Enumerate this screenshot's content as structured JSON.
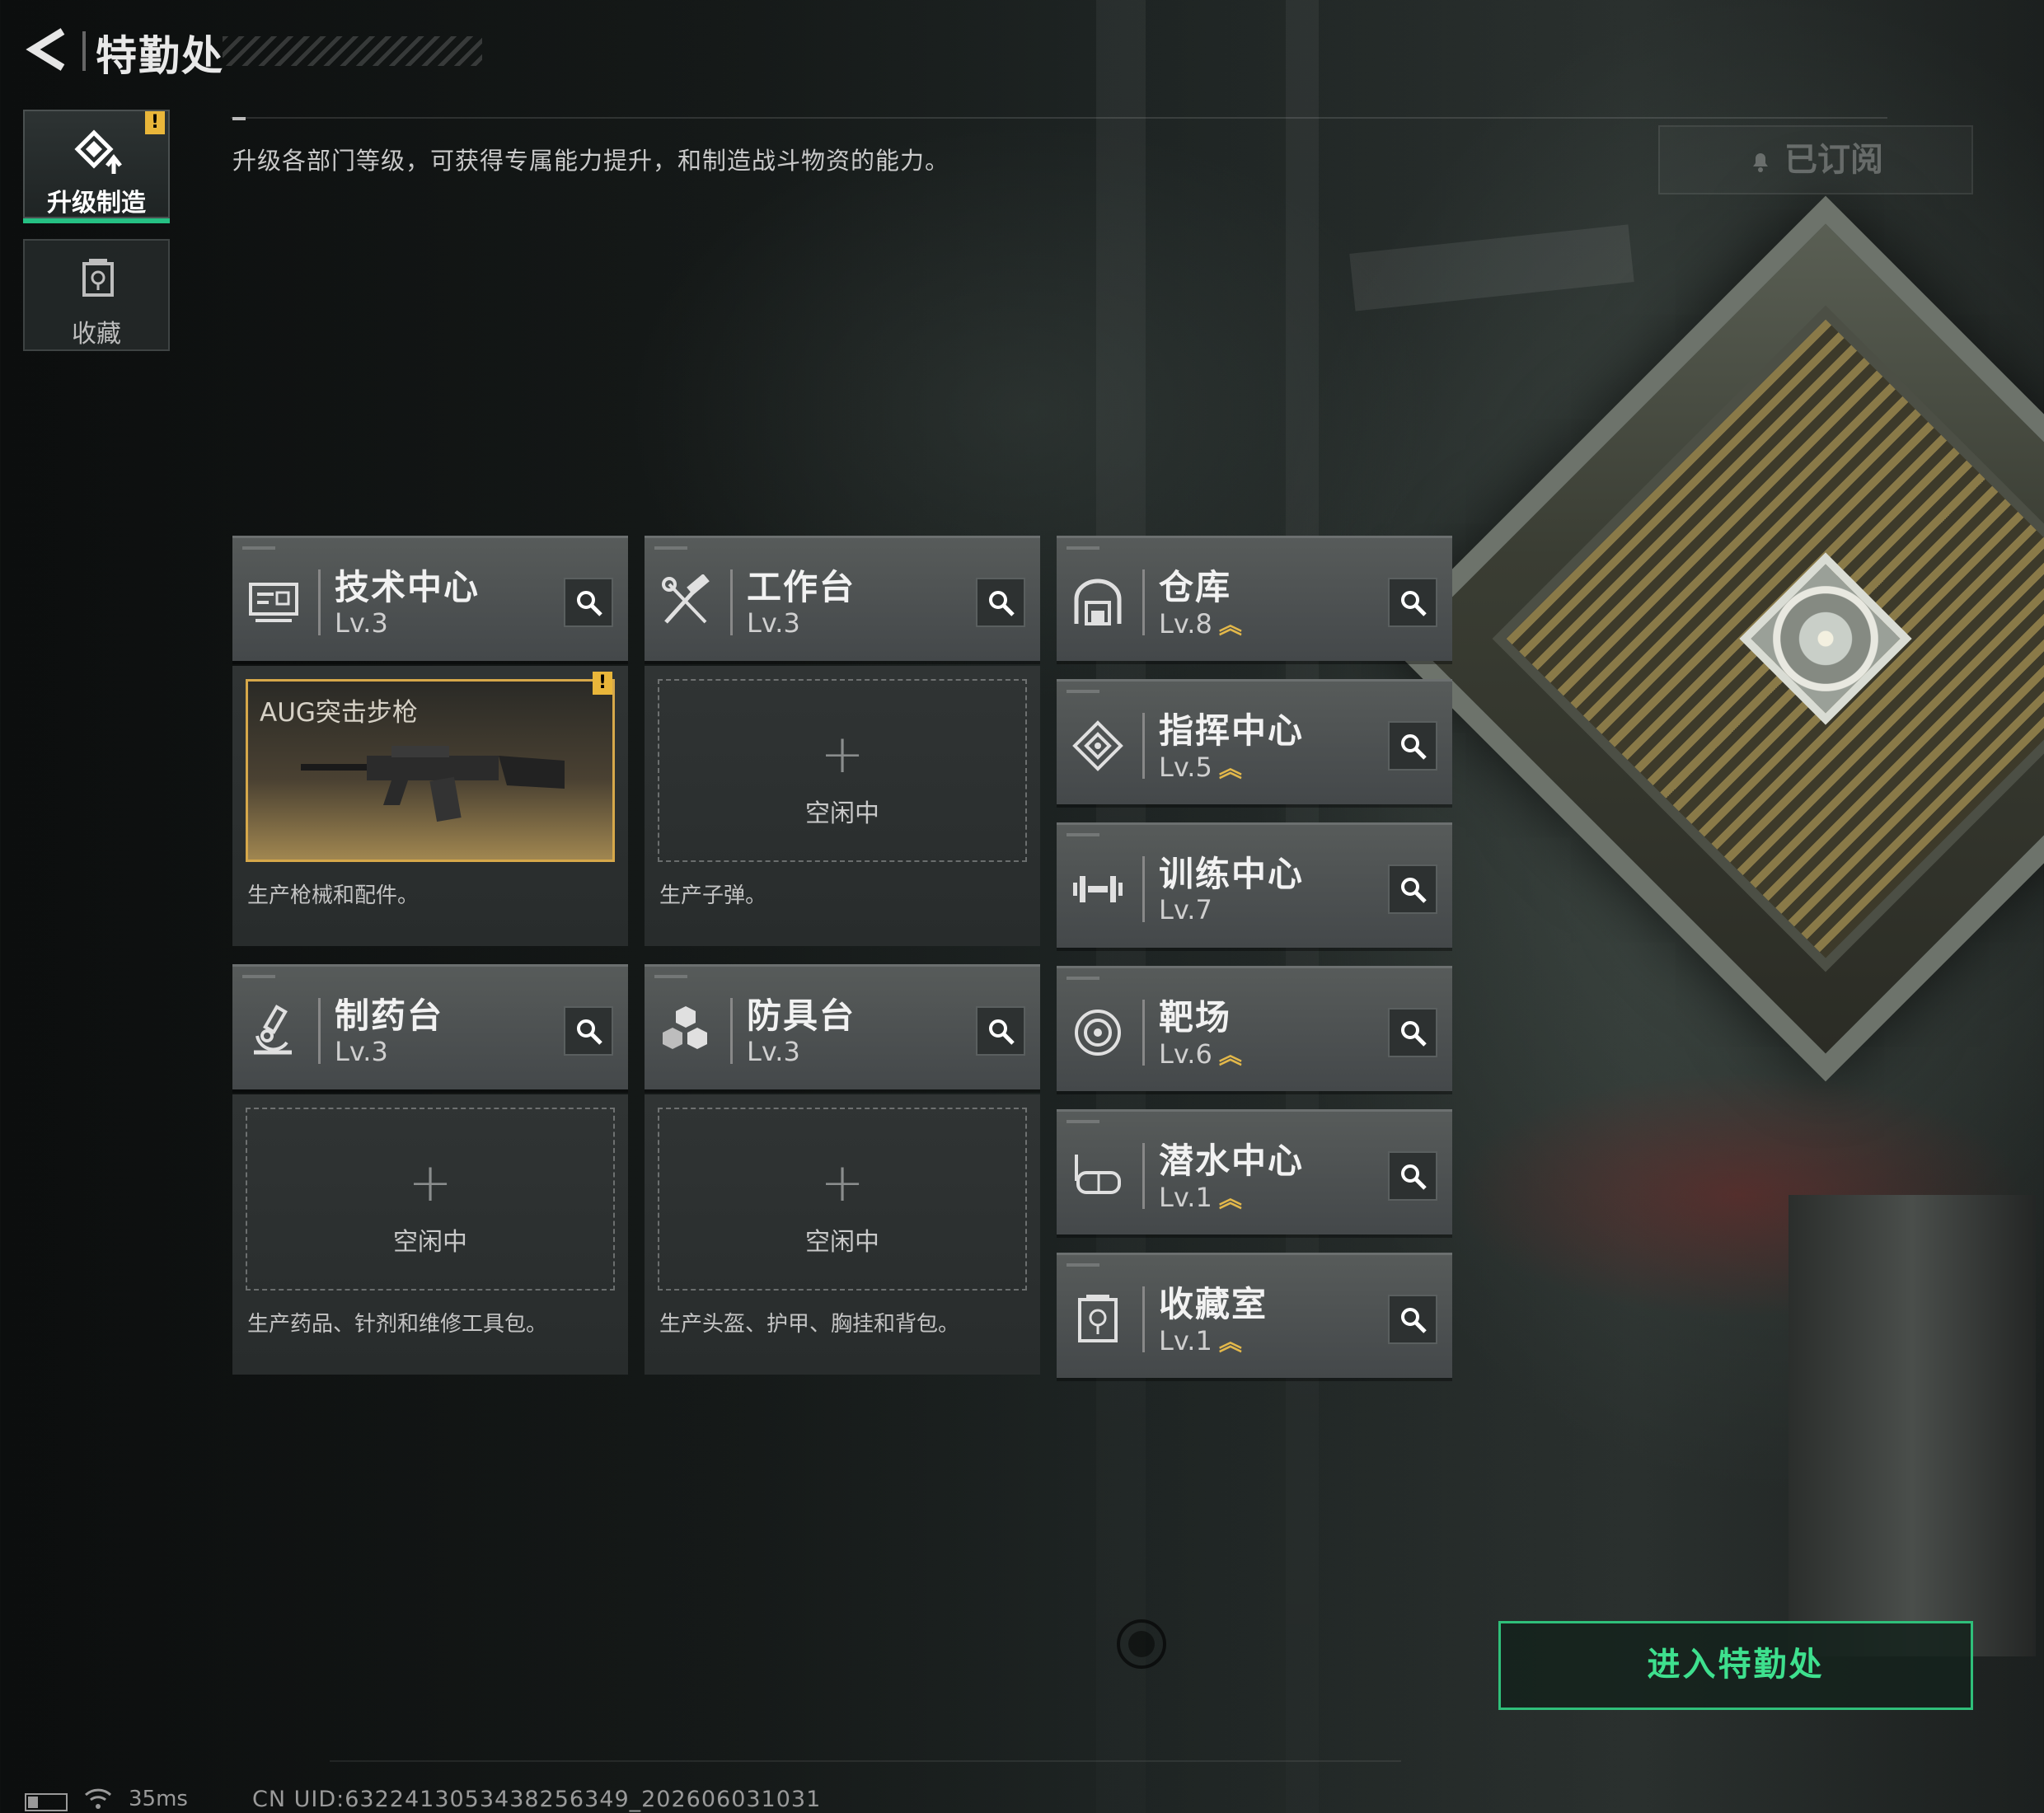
{
  "header": {
    "title": "特勤处"
  },
  "nav": {
    "items": [
      {
        "label": "升级制造",
        "icon": "upgrade-craft-icon",
        "active": true,
        "has_alert": true,
        "alert": "!"
      },
      {
        "label": "收藏",
        "icon": "collection-icon",
        "active": false
      }
    ]
  },
  "main": {
    "description": "升级各部门等级，可获得专属能力提升，和制造战斗物资的能力。",
    "subscribed_label": "已订阅",
    "enter_button": "进入特勤处"
  },
  "departments_left": [
    {
      "name": "技术中心",
      "level": "Lv.3",
      "icon": "monitor-icon",
      "slot": {
        "state": "producing",
        "item_name": "AUG突击步枪",
        "alert": "!"
      },
      "desc": "生产枪械和配件。"
    },
    {
      "name": "工作台",
      "level": "Lv.3",
      "icon": "tools-icon",
      "slot": {
        "state": "idle",
        "plus": "+",
        "idle_label": "空闲中"
      },
      "desc": "生产子弹。"
    },
    {
      "name": "制药台",
      "level": "Lv.3",
      "icon": "microscope-icon",
      "slot": {
        "state": "idle",
        "plus": "+",
        "idle_label": "空闲中"
      },
      "desc": "生产药品、针剂和维修工具包。"
    },
    {
      "name": "防具台",
      "level": "Lv.3",
      "icon": "armor-icon",
      "slot": {
        "state": "idle",
        "plus": "+",
        "idle_label": "空闲中"
      },
      "desc": "生产头盔、护甲、胸挂和背包。"
    }
  ],
  "departments_right": [
    {
      "name": "仓库",
      "level": "Lv.8",
      "upgradable": true,
      "icon": "warehouse-icon"
    },
    {
      "name": "指挥中心",
      "level": "Lv.5",
      "upgradable": true,
      "icon": "command-icon"
    },
    {
      "name": "训练中心",
      "level": "Lv.7",
      "upgradable": false,
      "icon": "dumbbell-icon"
    },
    {
      "name": "靶场",
      "level": "Lv.6",
      "upgradable": true,
      "icon": "target-icon"
    },
    {
      "name": "潜水中心",
      "level": "Lv.1",
      "upgradable": true,
      "icon": "diving-mask-icon"
    },
    {
      "name": "收藏室",
      "level": "Lv.1",
      "upgradable": true,
      "icon": "trophy-room-icon"
    }
  ],
  "upgrade_glyph": "︽",
  "status": {
    "ping": "35ms",
    "uid": "CN UID:6322413053438256349_202606031031"
  },
  "colors": {
    "accent": "#2fbf7a",
    "alert": "#e9b63a",
    "upgrade": "#e3b84a"
  }
}
